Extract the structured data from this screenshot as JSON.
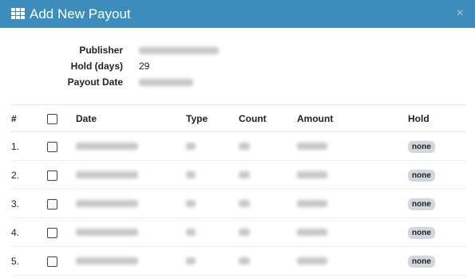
{
  "modal": {
    "title": "Add New Payout",
    "close_label": "×"
  },
  "details": {
    "publisher_label": "Publisher",
    "hold_label": "Hold (days)",
    "hold_value": "29",
    "payout_date_label": "Payout Date"
  },
  "table": {
    "headers": {
      "num": "#",
      "date": "Date",
      "type": "Type",
      "count": "Count",
      "amount": "Amount",
      "hold": "Hold"
    },
    "rows": [
      {
        "num": "1.",
        "hold": "none"
      },
      {
        "num": "2.",
        "hold": "none"
      },
      {
        "num": "3.",
        "hold": "none"
      },
      {
        "num": "4.",
        "hold": "none"
      },
      {
        "num": "5.",
        "hold": "none"
      }
    ]
  },
  "colors": {
    "header_bg": "#3c8dbc",
    "badge_bg": "#d2d6de"
  },
  "icons": {
    "title_icon": "grid-icon",
    "close_icon": "close-icon"
  }
}
